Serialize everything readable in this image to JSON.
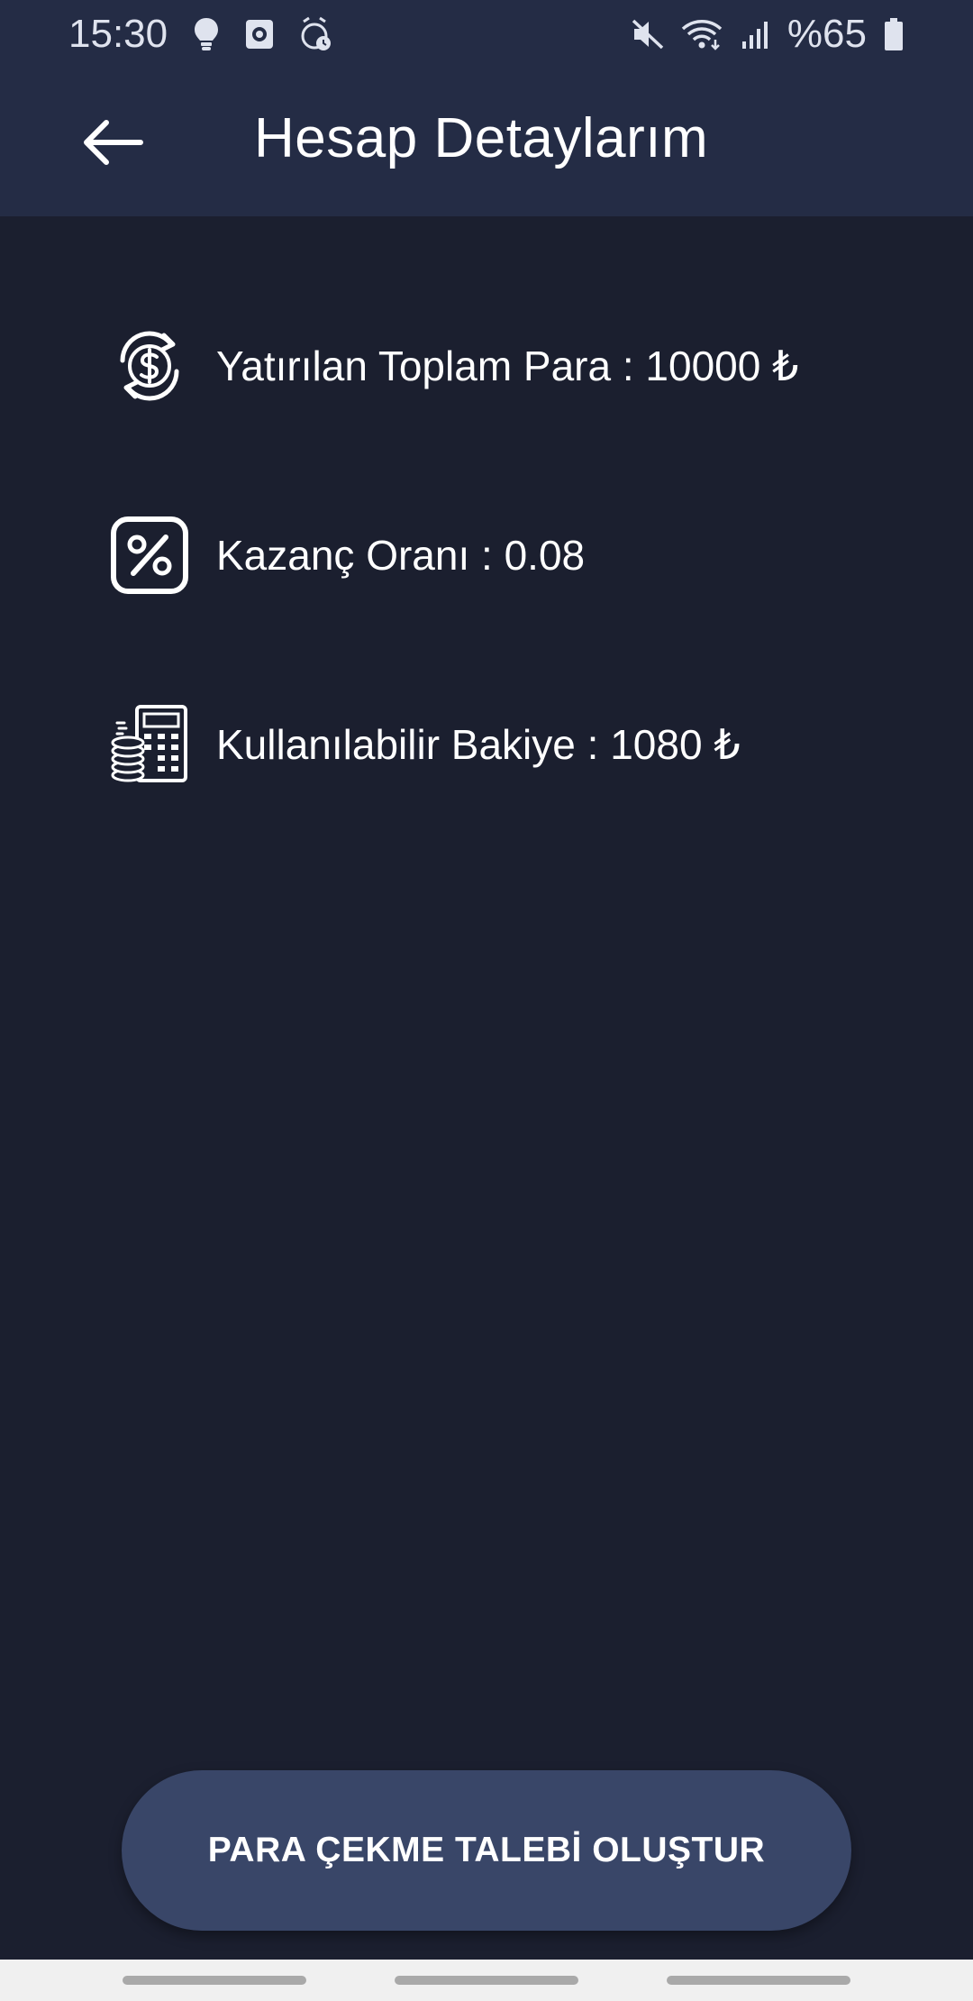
{
  "status_bar": {
    "time": "15:30",
    "battery": "%65",
    "icons_left": [
      "bulb-icon",
      "screen-record-icon",
      "alarm-clock-icon"
    ],
    "icons_right": [
      "mute-icon",
      "wifi-icon",
      "signal-icon",
      "battery-icon"
    ]
  },
  "header": {
    "title": "Hesap Detaylarım",
    "back_icon": "arrow-left-icon"
  },
  "details": [
    {
      "icon": "dollar-cycle-icon",
      "text": "Yatırılan Toplam Para : 10000 ₺"
    },
    {
      "icon": "percent-icon",
      "text": "Kazanç Oranı : 0.08"
    },
    {
      "icon": "calculator-coins-icon",
      "text": "Kullanılabilir Bakiye : 1080 ₺"
    }
  ],
  "actions": {
    "withdraw_label": "PARA ÇEKME TALEBİ OLUŞTUR"
  },
  "colors": {
    "background": "#1b1f2f",
    "header": "#242c45",
    "button": "#394668",
    "text": "#ffffff"
  }
}
